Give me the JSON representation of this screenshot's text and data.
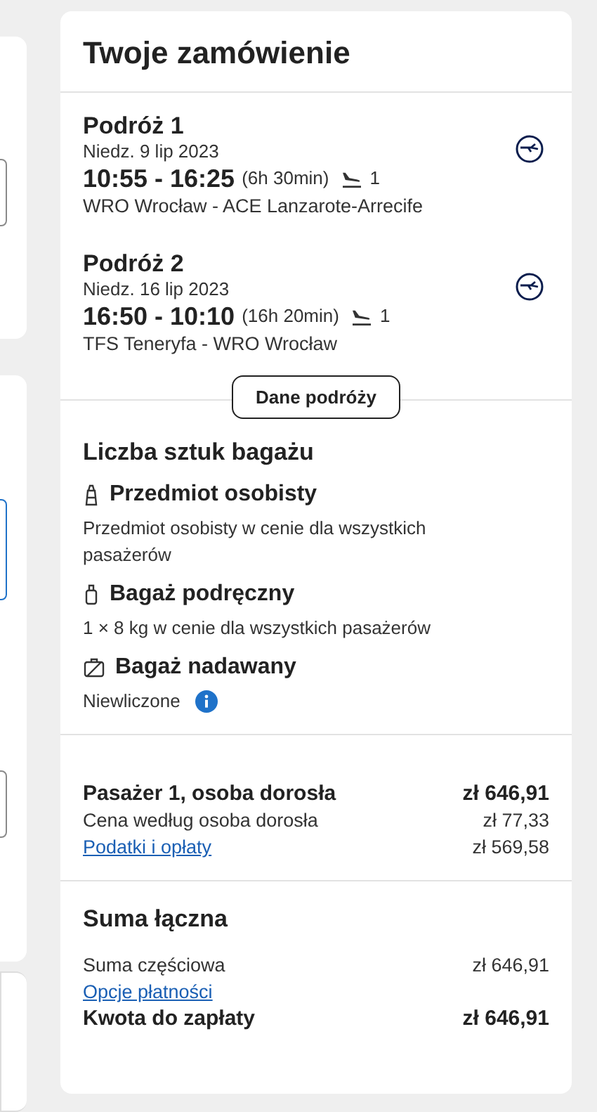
{
  "title": "Twoje zamówienie",
  "trips": [
    {
      "heading": "Podróż 1",
      "date": "Niedz. 9 lip 2023",
      "times": "10:55 - 16:25",
      "duration": "(6h 30min)",
      "stops": "1",
      "route": "WRO Wrocław - ACE Lanzarote-Arrecife"
    },
    {
      "heading": "Podróż 2",
      "date": "Niedz. 16 lip 2023",
      "times": "16:50 - 10:10",
      "duration": "(16h 20min)",
      "stops": "1",
      "route": "TFS Teneryfa - WRO Wrocław"
    }
  ],
  "details_button": "Dane podróży",
  "baggage": {
    "heading": "Liczba sztuk bagażu",
    "items": [
      {
        "kind": "personal",
        "title": "Przedmiot osobisty",
        "text": "Przedmiot osobisty w cenie dla wszystkich pasażerów",
        "info": false
      },
      {
        "kind": "cabin",
        "title": "Bagaż podręczny",
        "text": "1 × 8 kg w cenie dla wszystkich pasażerów",
        "info": false
      },
      {
        "kind": "checked",
        "title": "Bagaż nadawany",
        "text": "Niewliczone",
        "info": true
      }
    ]
  },
  "passenger": {
    "rows": [
      {
        "kind": "bold",
        "label": "Pasażer 1, osoba dorosła",
        "amount": "zł 646,91"
      },
      {
        "kind": "plain",
        "label": "Cena według osoba dorosła",
        "amount": "zł 77,33"
      },
      {
        "kind": "link",
        "label": "Podatki i opłaty",
        "amount": "zł 569,58"
      }
    ]
  },
  "total": {
    "heading": "Suma łączna",
    "rows": [
      {
        "kind": "plain",
        "label": "Suma częściowa",
        "amount": "zł 646,91"
      },
      {
        "kind": "link",
        "label": "Opcje płatności"
      },
      {
        "kind": "bold",
        "label": "Kwota do zapłaty",
        "amount": "zł 646,91"
      }
    ]
  }
}
